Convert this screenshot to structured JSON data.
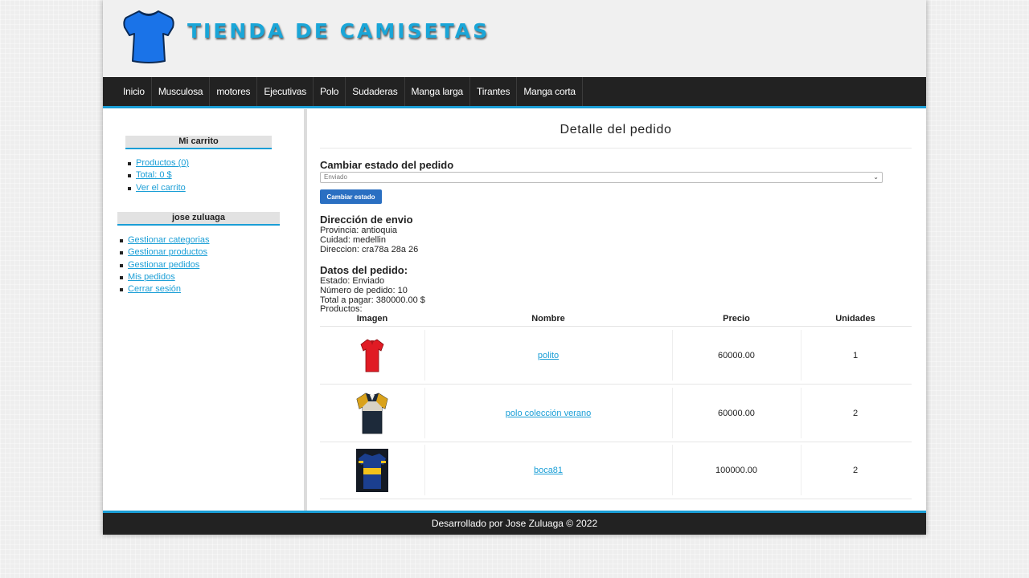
{
  "header": {
    "title": "TIENDA DE CAMISETAS",
    "logo_icon": "tshirt-icon",
    "brand_color": "#1aa6d8"
  },
  "menu": [
    "Inicio",
    "Musculosa",
    "motores",
    "Ejecutivas",
    "Polo",
    "Sudaderas",
    "Manga larga",
    "Tirantes",
    "Manga corta"
  ],
  "sidebar": {
    "cart": {
      "title": "Mi carrito",
      "products": "Productos (0)",
      "total": "Total: 0 $",
      "view": "Ver el carrito"
    },
    "user": {
      "name": "jose zuluaga",
      "links": [
        "Gestionar categorias",
        "Gestionar productos",
        "Gestionar pedidos",
        "Mis pedidos",
        "Cerrar sesión"
      ]
    }
  },
  "main": {
    "heading": "Detalle del pedido",
    "change_status": {
      "title": "Cambiar estado del pedido",
      "selected": "Enviado",
      "button": "Cambiar estado"
    },
    "shipping": {
      "title": "Dirección de envio",
      "province": "Provincia: antioquia",
      "city": "Cuidad: medellin",
      "address": "Direccion: cra78a 28a 26"
    },
    "order": {
      "title": "Datos del pedido:",
      "status": "Estado: Enviado",
      "number": "Número de pedido: 10",
      "total": "Total a pagar: 380000.00 $",
      "products_label": "Productos:"
    },
    "table": {
      "headers": [
        "Imagen",
        "Nombre",
        "Precio",
        "Unidades"
      ],
      "rows": [
        {
          "image": "red-polo-shirt",
          "name": "polito",
          "price": "60000.00",
          "units": "1"
        },
        {
          "image": "navy-yellow-polo-shirt",
          "name": "polo colección verano",
          "price": "60000.00",
          "units": "2"
        },
        {
          "image": "boca-jersey",
          "name": "boca81",
          "price": "100000.00",
          "units": "2"
        }
      ]
    }
  },
  "footer": {
    "text": "Desarrollado por Jose Zuluaga © 2022"
  }
}
